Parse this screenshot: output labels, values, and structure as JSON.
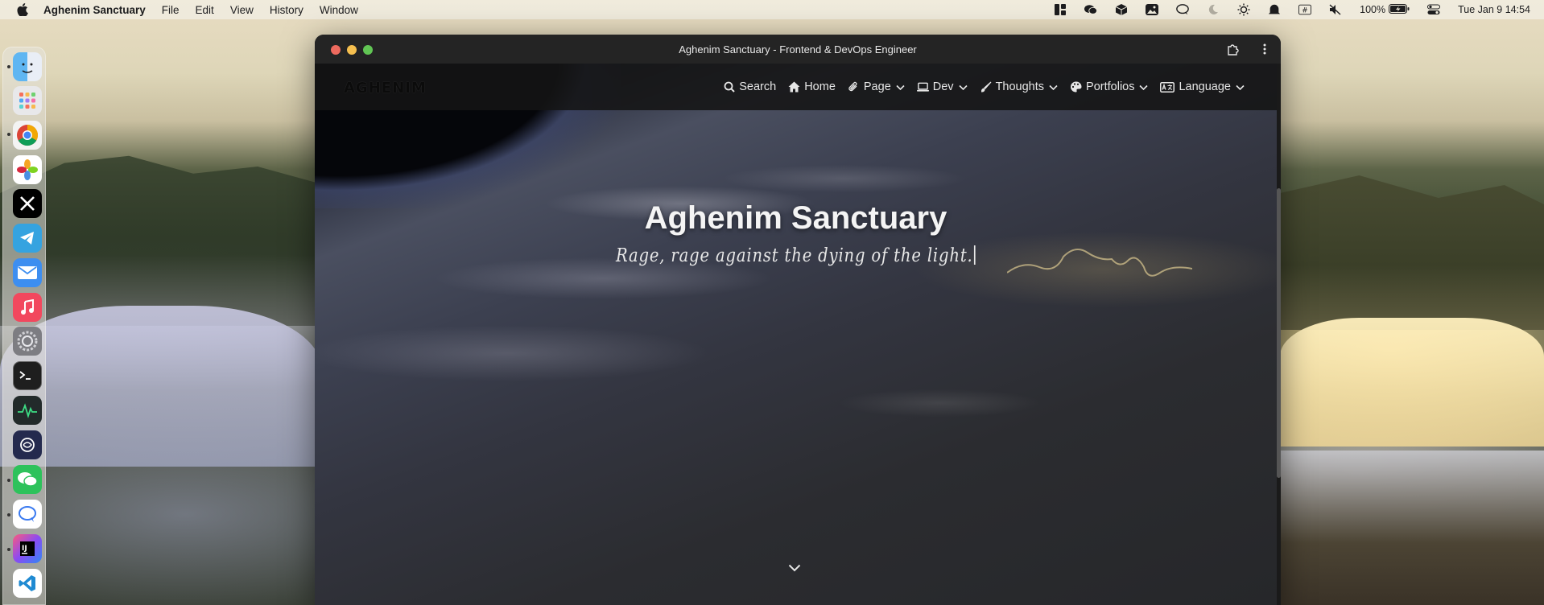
{
  "menubar": {
    "app_name": "Aghenim Sanctuary",
    "menus": [
      "File",
      "Edit",
      "View",
      "History",
      "Window"
    ],
    "battery": "100%",
    "clock": "Tue Jan 9  14:54",
    "tray_icons": [
      "widgets-icon",
      "wechat-icon",
      "package-icon",
      "photo-icon",
      "chat-icon",
      "moon-icon",
      "brightness-icon",
      "notification-icon",
      "hashtag-icon",
      "mute-icon",
      "battery-icon",
      "control-center-icon"
    ]
  },
  "dock": {
    "apps": [
      "finder-icon",
      "launchpad-icon",
      "chrome-icon",
      "photos-icon",
      "x-icon",
      "telegram-icon",
      "mail-icon",
      "music-icon",
      "system-settings-icon",
      "terminal-icon",
      "activity-monitor-icon",
      "chatgpt-icon",
      "wechat-icon",
      "chat-icon",
      "intellij-icon",
      "vscode-icon"
    ]
  },
  "window": {
    "title": "Aghenim Sanctuary - Frontend & DevOps Engineer"
  },
  "site": {
    "logo": "AGHENIM",
    "nav": [
      {
        "label": "Search",
        "icon": "search-icon"
      },
      {
        "label": "Home",
        "icon": "home-icon"
      },
      {
        "label": "Page",
        "icon": "paperclip-icon"
      },
      {
        "label": "Dev",
        "icon": "laptop-icon"
      },
      {
        "label": "Thoughts",
        "icon": "brush-icon"
      },
      {
        "label": "Portfolios",
        "icon": "palette-icon"
      },
      {
        "label": "Language",
        "icon": "language-icon"
      }
    ],
    "hero_title": "Aghenim Sanctuary",
    "hero_subtitle": "Rage, rage against the dying of the light."
  },
  "colors": {
    "menubar_bg": "#f0ecde",
    "window_bg": "#202020",
    "navbar_bg": "#141414",
    "text_light": "#f4f4f4"
  }
}
